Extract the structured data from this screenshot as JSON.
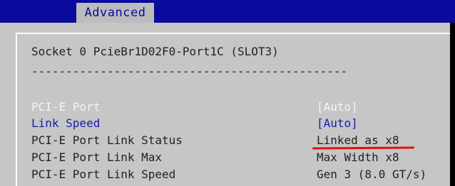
{
  "menu": {
    "active_tab": "Advanced"
  },
  "page": {
    "title": "Socket 0 PcieBr1D02F0-Port1C (SLOT3)",
    "separator": "----------------------------------------------"
  },
  "settings": [
    {
      "label": "PCI-E Port",
      "value": "[Auto]"
    },
    {
      "label": "Link Speed",
      "value": "[Auto]"
    },
    {
      "label": "PCI-E Port Link Status",
      "value": "Linked as x8"
    },
    {
      "label": "PCI-E Port Link Max",
      "value": "Max Width x8"
    },
    {
      "label": "PCI-E Port Link Speed",
      "value": "Gen 3 (8.0 GT/s)"
    }
  ],
  "colors": {
    "header_bg": "#0a0a9c",
    "panel_bg": "#c6c6c6",
    "highlight_text": "#f4f4f4",
    "selectable_text": "#1a1ab4",
    "annotation": "#e11010"
  }
}
